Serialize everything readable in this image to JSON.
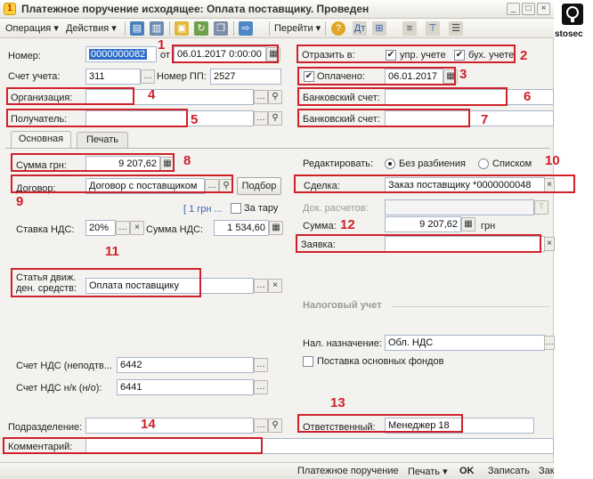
{
  "window": {
    "title": "Платежное поручение исходящее: Оплата поставщику. Проведен",
    "min": "_",
    "max": "□",
    "close": "×"
  },
  "logo": {
    "text": "stosec"
  },
  "toolbar": {
    "operation": "Операция ▾",
    "actions": "Действия ▾",
    "goto": "Перейти ▾"
  },
  "header": {
    "number_label": "Номер:",
    "number_value": "0000000082",
    "from_label": "от",
    "date_value": "06.01.2017  0:00:00",
    "account_label": "Счет учета:",
    "account_value": "311",
    "pp_label": "Номер ПП:",
    "pp_value": "2527",
    "reflect_label": "Отразить в:",
    "mgmt_label": "упр. учете",
    "acct_label": "бух. учете",
    "paid_label": "Оплачено:",
    "paid_date": "06.01.2017"
  },
  "org": {
    "org_label": "Организация:",
    "bank_label": "Банковский счет:",
    "recipient_label": "Получатель:",
    "bank2_label": "Банковский счет:"
  },
  "tabs": {
    "main": "Основная",
    "print": "Печать"
  },
  "left": {
    "sum_label": "Сумма грн:",
    "sum_value": "9 207,62",
    "contract_label": "Договор:",
    "contract_value": "Договор с поставщиком",
    "pick_label": "Подбор",
    "rate_text": "[ 1 грн ...",
    "container_label": "За тару",
    "vat_rate_label": "Ставка НДС:",
    "vat_rate_value": "20%",
    "vat_sum_label": "Сумма НДС:",
    "vat_sum_value": "1 534,60",
    "cashflow_label1": "Статья движ.",
    "cashflow_label2": "ден. средств:",
    "cashflow_value": "Оплата поставщику",
    "vat_account_label": "Счет НДС (неподтв...",
    "vat_account_value": "6442",
    "vat_account2_label": "Счет НДС н/к (н/о):",
    "vat_account2_value": "6441"
  },
  "right": {
    "edit_label": "Редактировать:",
    "radio1": "Без разбиения",
    "radio2": "Списком",
    "deal_label": "Сделка:",
    "deal_value": "Заказ поставщику *0000000048",
    "doc_label": "Док. расчетов:",
    "sum_label": "Сумма:",
    "sum_value": "9 207,62",
    "currency": "грн",
    "request_label": "Заявка:",
    "tax_section": "Налоговый учет",
    "tax_purpose_label": "Нал. назначение:",
    "tax_purpose_value": "Обл. НДС",
    "fixed_assets_label": "Поставка основных фондов"
  },
  "bottom": {
    "division_label": "Подразделение:",
    "responsible_label": "Ответственный:",
    "responsible_value": "Менеджер 18",
    "comment_label": "Комментарий:"
  },
  "footer": {
    "doc": "Платежное поручение",
    "print": "Печать ▾",
    "ok": "OK",
    "save": "Записать",
    "close": "Закрыть"
  },
  "markers": [
    "1",
    "2",
    "3",
    "4",
    "5",
    "6",
    "7",
    "8",
    "9",
    "10",
    "11",
    "12",
    "13",
    "14"
  ],
  "colors": {
    "highlight": "#d0212b",
    "selection": "#2f6ec8"
  }
}
